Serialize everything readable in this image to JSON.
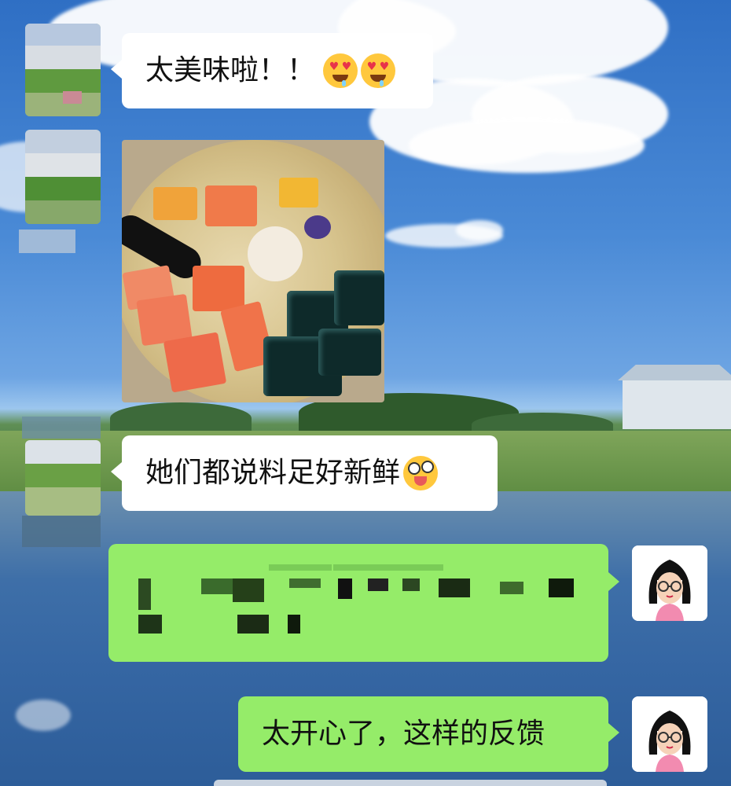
{
  "chat": {
    "messages": [
      {
        "from": "other",
        "text": "太美味啦！！",
        "emoji": "heart-eyes-drool-emoji x2"
      },
      {
        "from": "other",
        "type": "image",
        "description_icon": "dessert-photo"
      },
      {
        "from": "other",
        "text": "她们都说料足好新鲜",
        "emoji": "crazy-face-emoji"
      },
      {
        "from": "me",
        "text": "",
        "note": "pixelated content"
      },
      {
        "from": "me",
        "text": "太开心了，这样的反馈"
      }
    ]
  },
  "colors": {
    "bubble_white": "#ffffff",
    "bubble_green": "#95ec69"
  }
}
